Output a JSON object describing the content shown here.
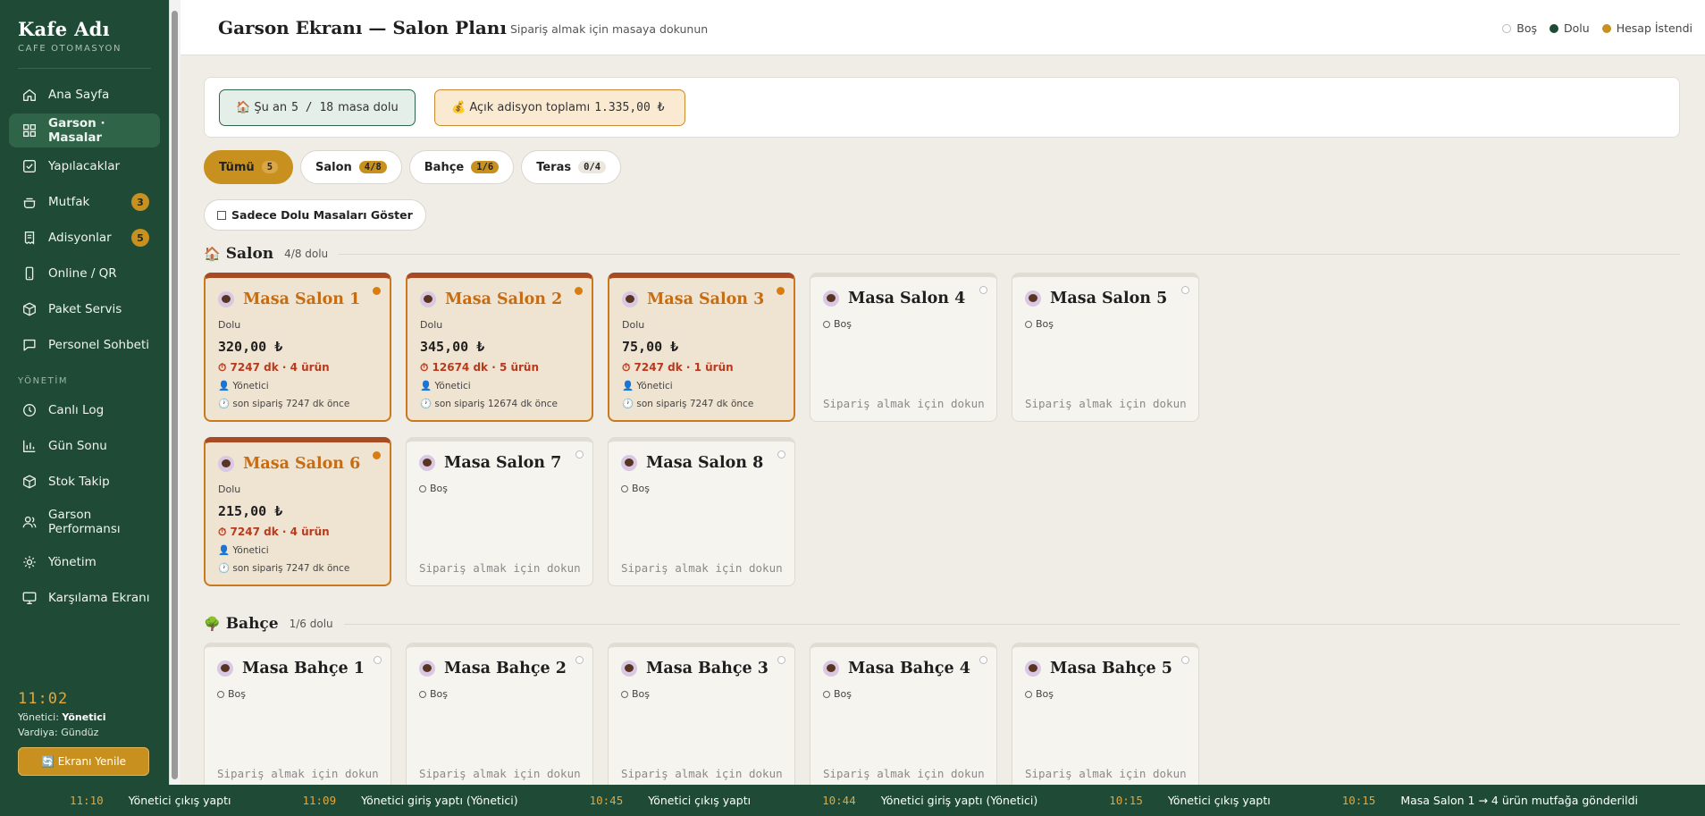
{
  "brand": {
    "title": "Kafe Adı",
    "subtitle": "CAFE OTOMASYON"
  },
  "nav": [
    {
      "label": "Ana Sayfa",
      "icon": "home-icon",
      "active": false
    },
    {
      "label": "Garson · Masalar",
      "icon": "grid-icon",
      "active": true
    },
    {
      "label": "Yapılacaklar",
      "icon": "checkbox-icon",
      "active": false
    },
    {
      "label": "Mutfak",
      "icon": "cooking-pot-icon",
      "active": false,
      "badge": "3"
    },
    {
      "label": "Adisyonlar",
      "icon": "receipt-icon",
      "active": false,
      "badge": "5"
    },
    {
      "label": "Online / QR",
      "icon": "smartphone-icon",
      "active": false
    },
    {
      "label": "Paket Servis",
      "icon": "package-icon",
      "active": false
    },
    {
      "label": "Personel Sohbeti",
      "icon": "chat-icon",
      "active": false
    }
  ],
  "nav_section": "YÖNETİM",
  "nav_admin": [
    {
      "label": "Canlı Log",
      "icon": "clock-icon"
    },
    {
      "label": "Gün Sonu",
      "icon": "bar-chart-icon"
    },
    {
      "label": "Stok Takip",
      "icon": "box-icon"
    },
    {
      "label": "Garson Performansı",
      "icon": "users-icon"
    },
    {
      "label": "Yönetim",
      "icon": "gear-icon"
    },
    {
      "label": "Karşılama Ekranı",
      "icon": "monitor-icon"
    }
  ],
  "footer": {
    "clock": "11:02",
    "manager_label": "Yönetici:",
    "manager_name": "Yönetici",
    "shift": "Vardiya: Gündüz",
    "refresh": "🔄 Ekranı Yenile"
  },
  "header": {
    "title": "Garson Ekranı — Salon Planı",
    "subtitle": "Sipariş almak için masaya dokunun",
    "legend": [
      {
        "label": "Boş",
        "color": "#ffffff"
      },
      {
        "label": "Dolu",
        "color": "#1f4a36"
      },
      {
        "label": "Hesap İstendi",
        "color": "#c8911f"
      }
    ]
  },
  "summary": {
    "occupied_prefix": "🏠 Şu an",
    "occupied_value": "5 / 18",
    "occupied_suffix": "masa dolu",
    "open_prefix": "💰 Açık adisyon toplamı",
    "open_value": "1.335,00 ₺"
  },
  "filters": [
    {
      "label": "Tümü",
      "count": "5",
      "active": true
    },
    {
      "label": "Salon",
      "count": "4/8",
      "active": false
    },
    {
      "label": "Bahçe",
      "count": "1/6",
      "active": false
    },
    {
      "label": "Teras",
      "count": "0/4",
      "active": false
    }
  ],
  "only_full_label": "Sadece Dolu Masaları Göster",
  "sections": [
    {
      "icon": "🏠",
      "name": "Salon",
      "count": "4/8 dolu",
      "tables": [
        {
          "name": "Masa Salon 1",
          "full": true,
          "state": "Dolu",
          "amount": "320,00 ₺",
          "time": "⏱ 7247 dk · 4 ürün",
          "user": "👤 Yönetici",
          "last": "🕐 son sipariş 7247 dk önce"
        },
        {
          "name": "Masa Salon 2",
          "full": true,
          "state": "Dolu",
          "amount": "345,00 ₺",
          "time": "⏱ 12674 dk · 5 ürün",
          "user": "👤 Yönetici",
          "last": "🕐 son sipariş 12674 dk önce"
        },
        {
          "name": "Masa Salon 3",
          "full": true,
          "state": "Dolu",
          "amount": "75,00 ₺",
          "time": "⏱ 7247 dk · 1 ürün",
          "user": "👤 Yönetici",
          "last": "🕐 son sipariş 7247 dk önce"
        },
        {
          "name": "Masa Salon 4",
          "full": false,
          "state": "Boş",
          "hint": "Sipariş almak için dokun"
        },
        {
          "name": "Masa Salon 5",
          "full": false,
          "state": "Boş",
          "hint": "Sipariş almak için dokun"
        },
        {
          "name": "Masa Salon 6",
          "full": true,
          "state": "Dolu",
          "amount": "215,00 ₺",
          "time": "⏱ 7247 dk · 4 ürün",
          "user": "👤 Yönetici",
          "last": "🕐 son sipariş 7247 dk önce"
        },
        {
          "name": "Masa Salon 7",
          "full": false,
          "state": "Boş",
          "hint": "Sipariş almak için dokun"
        },
        {
          "name": "Masa Salon 8",
          "full": false,
          "state": "Boş",
          "hint": "Sipariş almak için dokun"
        }
      ]
    },
    {
      "icon": "🌳",
      "name": "Bahçe",
      "count": "1/6 dolu",
      "tables": [
        {
          "name": "Masa Bahçe 1",
          "full": false,
          "state": "Boş",
          "hint": "Sipariş almak için dokun"
        },
        {
          "name": "Masa Bahçe 2",
          "full": false,
          "state": "Boş",
          "hint": "Sipariş almak için dokun"
        },
        {
          "name": "Masa Bahçe 3",
          "full": false,
          "state": "Boş",
          "hint": "Sipariş almak için dokun"
        },
        {
          "name": "Masa Bahçe 4",
          "full": false,
          "state": "Boş",
          "hint": "Sipariş almak için dokun"
        },
        {
          "name": "Masa Bahçe 5",
          "full": false,
          "state": "Boş",
          "hint": "Sipariş almak için dokun"
        }
      ]
    }
  ],
  "ticker": [
    {
      "time": "11:10",
      "text": "Yönetici çıkış yaptı"
    },
    {
      "time": "11:09",
      "text": "Yönetici giriş yaptı (Yönetici)"
    },
    {
      "time": "10:45",
      "text": "Yönetici çıkış yaptı"
    },
    {
      "time": "10:44",
      "text": "Yönetici giriş yaptı (Yönetici)"
    },
    {
      "time": "10:15",
      "text": "Yönetici çıkış yaptı"
    },
    {
      "time": "10:15",
      "text": "Masa Salon 1 → 4 ürün mutfağa gönderildi"
    },
    {
      "time": "10:15",
      "text": ""
    }
  ]
}
